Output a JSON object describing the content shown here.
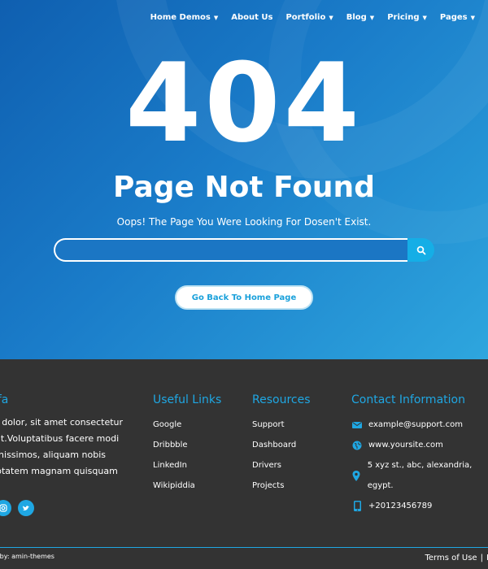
{
  "nav": {
    "items": [
      {
        "label": "Home Demos",
        "caret": "▼"
      },
      {
        "label": "About Us",
        "caret": ""
      },
      {
        "label": "Portfolio",
        "caret": "▼"
      },
      {
        "label": "Blog",
        "caret": "▼"
      },
      {
        "label": "Pricing",
        "caret": "▼"
      },
      {
        "label": "Pages",
        "caret": "▼"
      }
    ]
  },
  "hero": {
    "code": "404",
    "title": "Page Not Found",
    "subtitle": "Oops! The Page You Were Looking For Dosen't Exist.",
    "search_value": "",
    "search_placeholder": "",
    "home_button": "Go Back To Home Page"
  },
  "footer": {
    "about": {
      "title": "ufa",
      "lines": [
        "m dolor, sit amet consectetur",
        "elit.Voluptatibus facere modi",
        "ignissimos, aliquam nobis",
        "uptatem magnam quisquam"
      ]
    },
    "links": {
      "title": "Useful Links",
      "items": [
        "Google",
        "Dribbble",
        "LinkedIn",
        "Wikipiddia"
      ]
    },
    "resources": {
      "title": "Resources",
      "items": [
        "Support",
        "Dashboard",
        "Drivers",
        "Projects"
      ]
    },
    "contact": {
      "title": "Contact Information",
      "email": "example@support.com",
      "website": "www.yoursite.com",
      "address": "5 xyz st., abc, alexandria, egypt.",
      "phone": "+20123456789"
    },
    "credit": "d by: amin-themes",
    "terms": "Terms of Use",
    "separator": "|",
    "privacy": "P"
  },
  "colors": {
    "accent": "#1fa7e3",
    "footer_bg": "#333333",
    "hero_start": "#0f5fb0",
    "hero_end": "#2ea6de"
  }
}
